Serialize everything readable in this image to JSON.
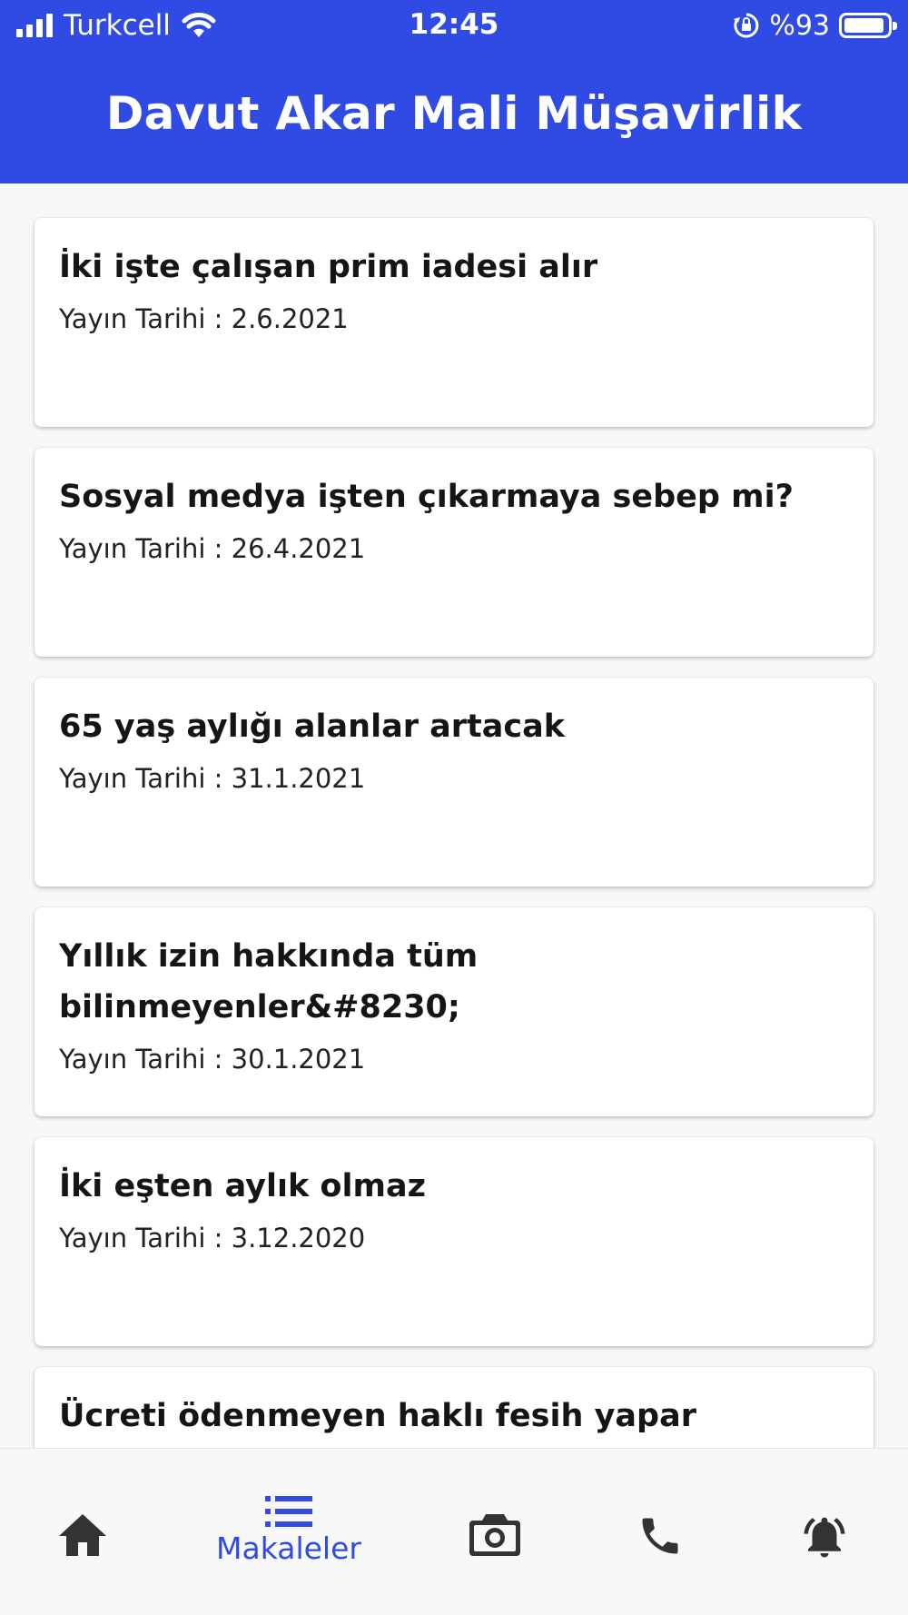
{
  "status_bar": {
    "carrier": "Turkcell",
    "time": "12:45",
    "battery_text": "%93",
    "battery_level": 0.93
  },
  "header": {
    "title": "Davut Akar Mali Müşavirlik"
  },
  "articles": [
    {
      "title": "İki işte çalışan prim iadesi alır",
      "date": "Yayın Tarihi : 2.6.2021"
    },
    {
      "title": "Sosyal medya işten çıkarmaya sebep mi?",
      "date": "Yayın Tarihi : 26.4.2021"
    },
    {
      "title": "65 yaş aylığı alanlar artacak",
      "date": "Yayın Tarihi : 31.1.2021"
    },
    {
      "title": "Yıllık izin hakkında tüm",
      "title_line2": "bilinmeyenler&#8230;",
      "date": "Yayın Tarihi : 30.1.2021"
    },
    {
      "title": "İki eşten aylık olmaz",
      "date": "Yayın Tarihi : 3.12.2020"
    },
    {
      "title": "Ücreti ödenmeyen haklı fesih yapar"
    }
  ],
  "bottom_nav": {
    "items": [
      {
        "icon": "home-icon"
      },
      {
        "icon": "list-icon",
        "label": "Makaleler",
        "active": true
      },
      {
        "icon": "camera-icon"
      },
      {
        "icon": "phone-icon"
      },
      {
        "icon": "bell-icon"
      }
    ]
  },
  "colors": {
    "primary": "#2f4be3",
    "background": "#f8f8f8",
    "icon": "#333333"
  }
}
